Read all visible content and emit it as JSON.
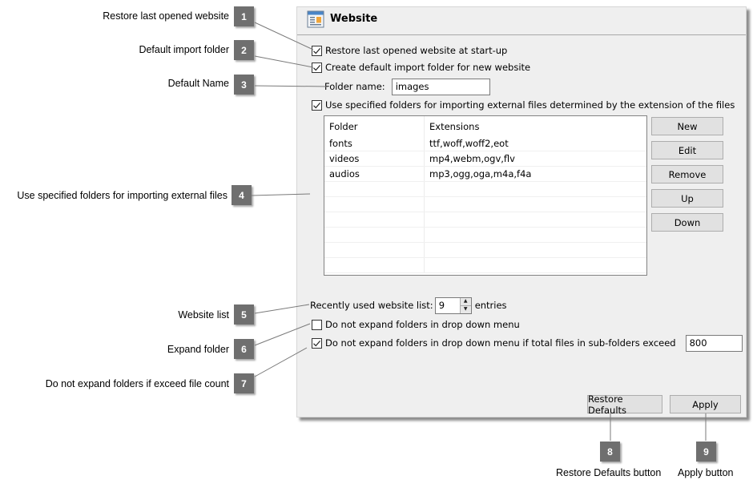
{
  "callouts": [
    {
      "number": "1",
      "label": "Restore last opened website"
    },
    {
      "number": "2",
      "label": "Default import folder"
    },
    {
      "number": "3",
      "label": "Default Name"
    },
    {
      "number": "4",
      "label": "Use specified folders for importing external files"
    },
    {
      "number": "5",
      "label": "Website list"
    },
    {
      "number": "6",
      "label": "Expand folder"
    },
    {
      "number": "7",
      "label": "Do not expand folders if exceed file count"
    },
    {
      "number": "8",
      "label": "Restore Defaults button"
    },
    {
      "number": "9",
      "label": "Apply button"
    }
  ],
  "panel": {
    "icon": "page-icon",
    "title": "Website",
    "restore_last": {
      "label": "Restore last opened website at start-up",
      "checked": true
    },
    "create_default": {
      "label": "Create default import folder for new website",
      "checked": true
    },
    "folder_name": {
      "label": "Folder name:",
      "value": "images"
    },
    "use_specified": {
      "label": "Use specified folders for importing external files determined by the extension of the files",
      "checked": true
    },
    "table": {
      "columns": [
        "Folder",
        "Extensions"
      ],
      "rows": [
        {
          "folder": "fonts",
          "extensions": "ttf,woff,woff2,eot"
        },
        {
          "folder": "videos",
          "extensions": "mp4,webm,ogv,flv"
        },
        {
          "folder": "audios",
          "extensions": "mp3,ogg,oga,m4a,f4a"
        }
      ],
      "empty_rows": 6
    },
    "side_buttons": {
      "new": "New",
      "edit": "Edit",
      "remove": "Remove",
      "up": "Up",
      "down": "Down"
    },
    "recent_list": {
      "label": "Recently used website list:",
      "value": "9",
      "suffix": "entries"
    },
    "no_expand": {
      "label": "Do not expand folders in drop down menu",
      "checked": false
    },
    "no_expand_exceed": {
      "label": "Do not expand folders in drop down menu if total files in sub-folders exceed",
      "checked": true,
      "value": "800"
    },
    "footer": {
      "restore_defaults": "Restore Defaults",
      "apply": "Apply"
    }
  }
}
